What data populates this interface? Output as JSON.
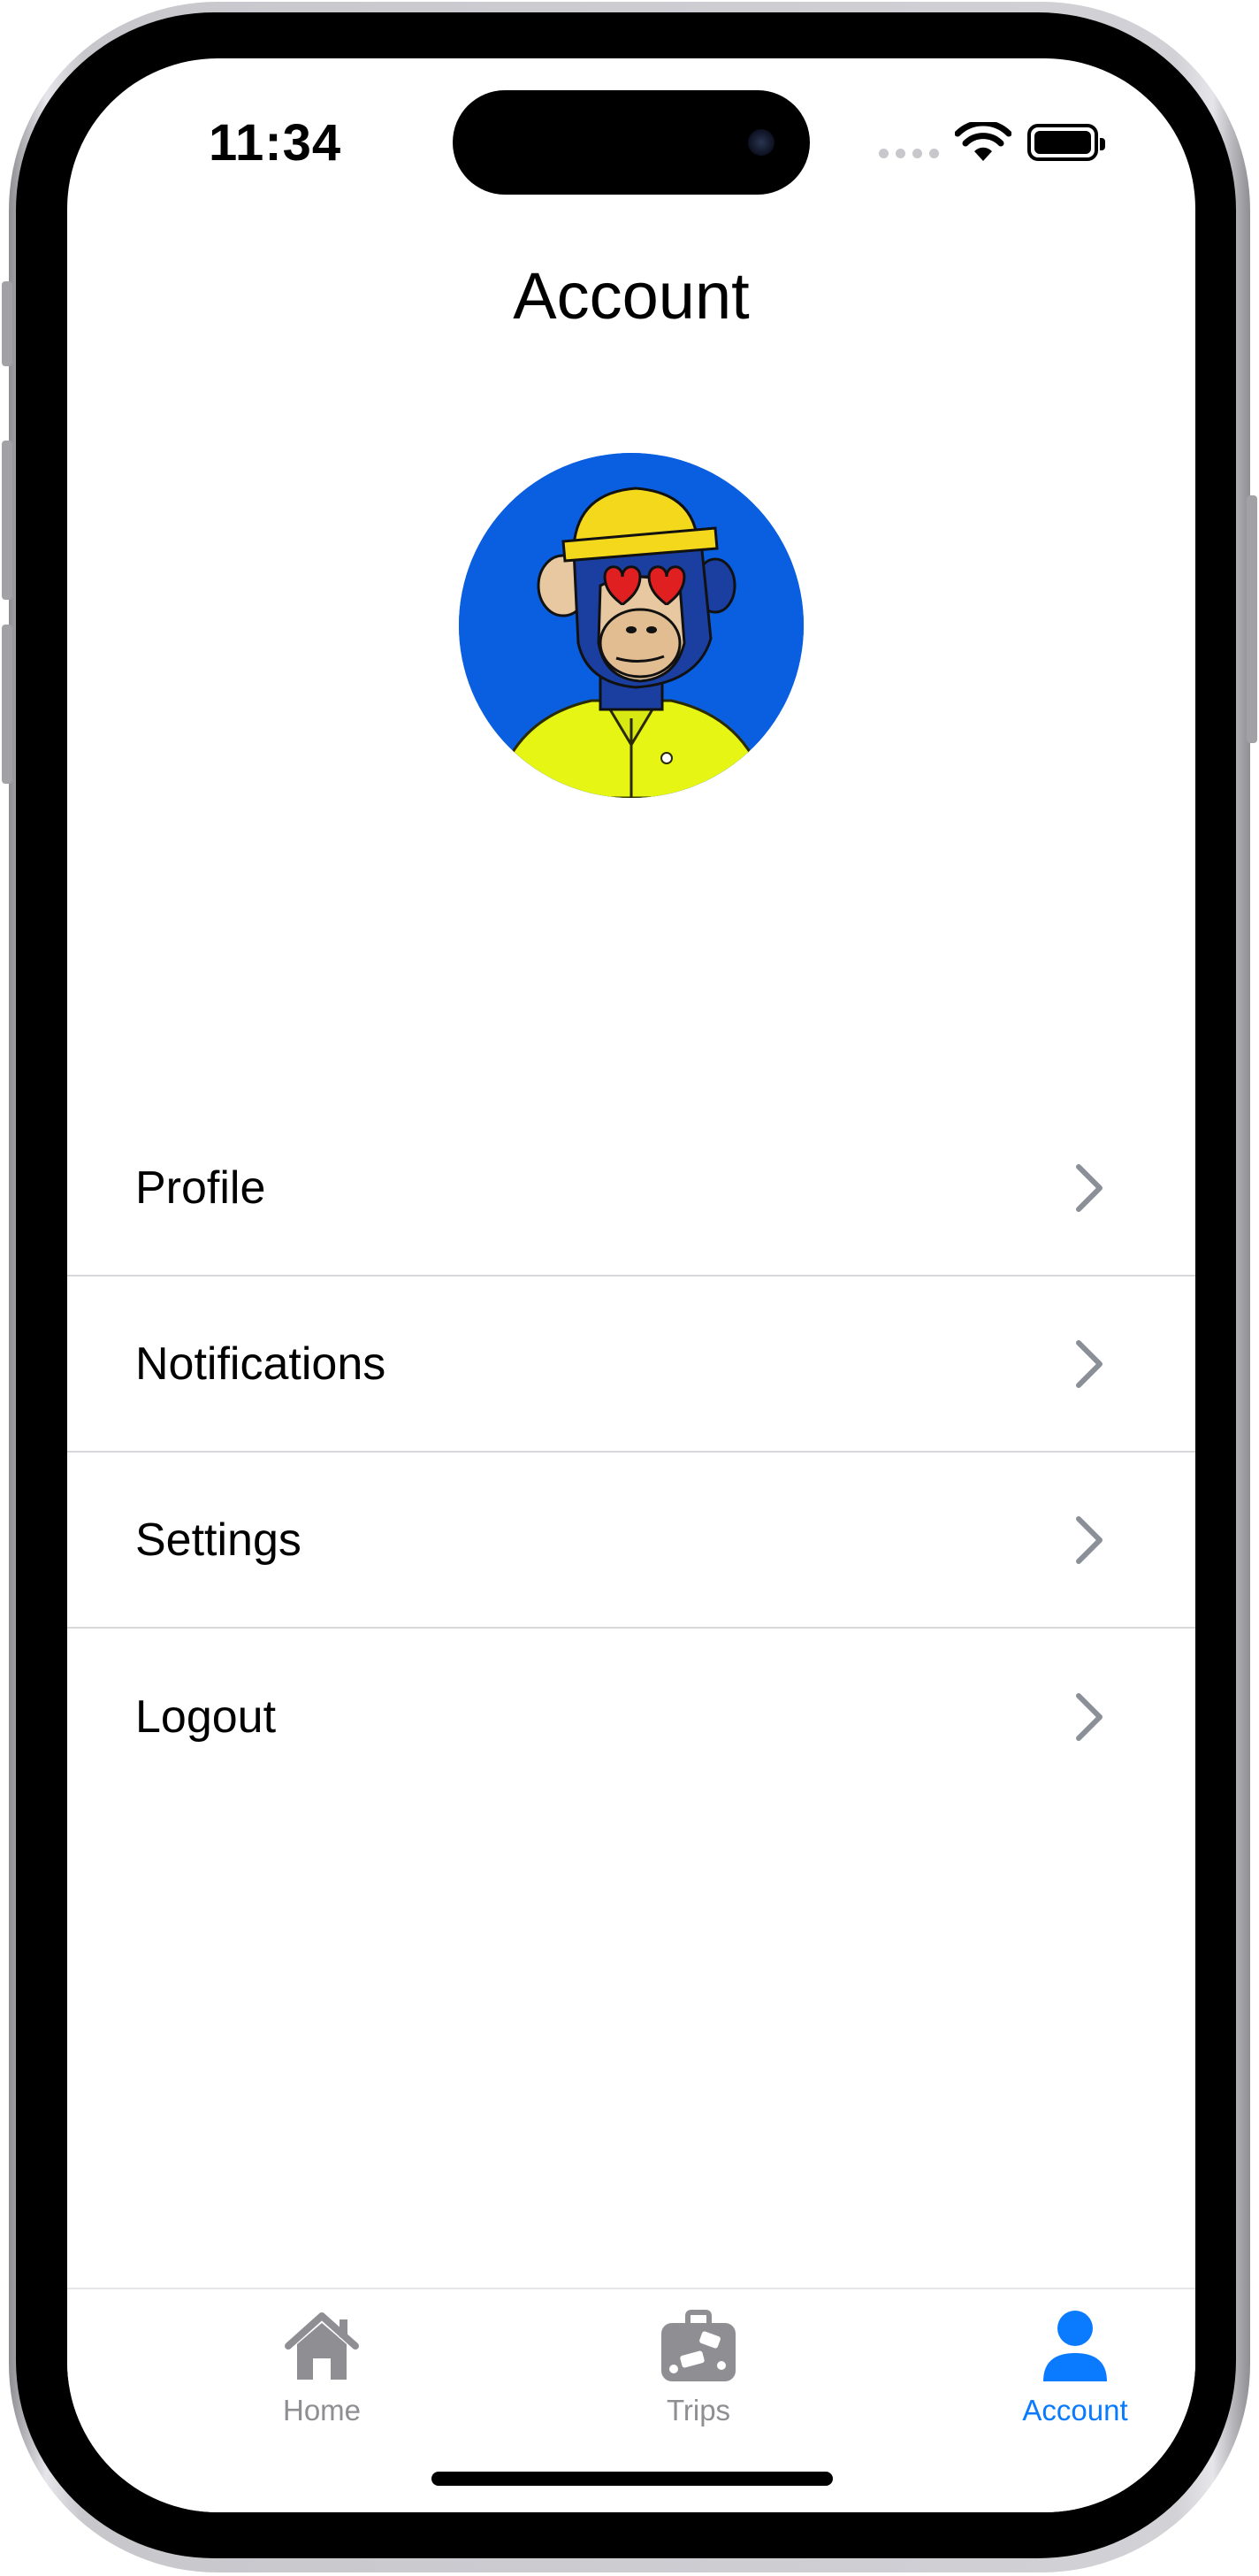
{
  "status_bar": {
    "time": "11:34"
  },
  "header": {
    "title": "Account"
  },
  "menu": {
    "items": [
      {
        "label": "Profile"
      },
      {
        "label": "Notifications"
      },
      {
        "label": "Settings"
      },
      {
        "label": "Logout"
      }
    ]
  },
  "tab_bar": {
    "tabs": [
      {
        "label": "Home",
        "icon": "house-icon",
        "active": false
      },
      {
        "label": "Trips",
        "icon": "suitcase-icon",
        "active": false
      },
      {
        "label": "Account",
        "icon": "person-icon",
        "active": true
      }
    ]
  },
  "colors": {
    "accent": "#0A7AFF",
    "inactive": "#8E8E93",
    "chevron": "#8A8F98",
    "separator": "#D8D8DC",
    "avatar_bg": "#0A5FE0"
  }
}
